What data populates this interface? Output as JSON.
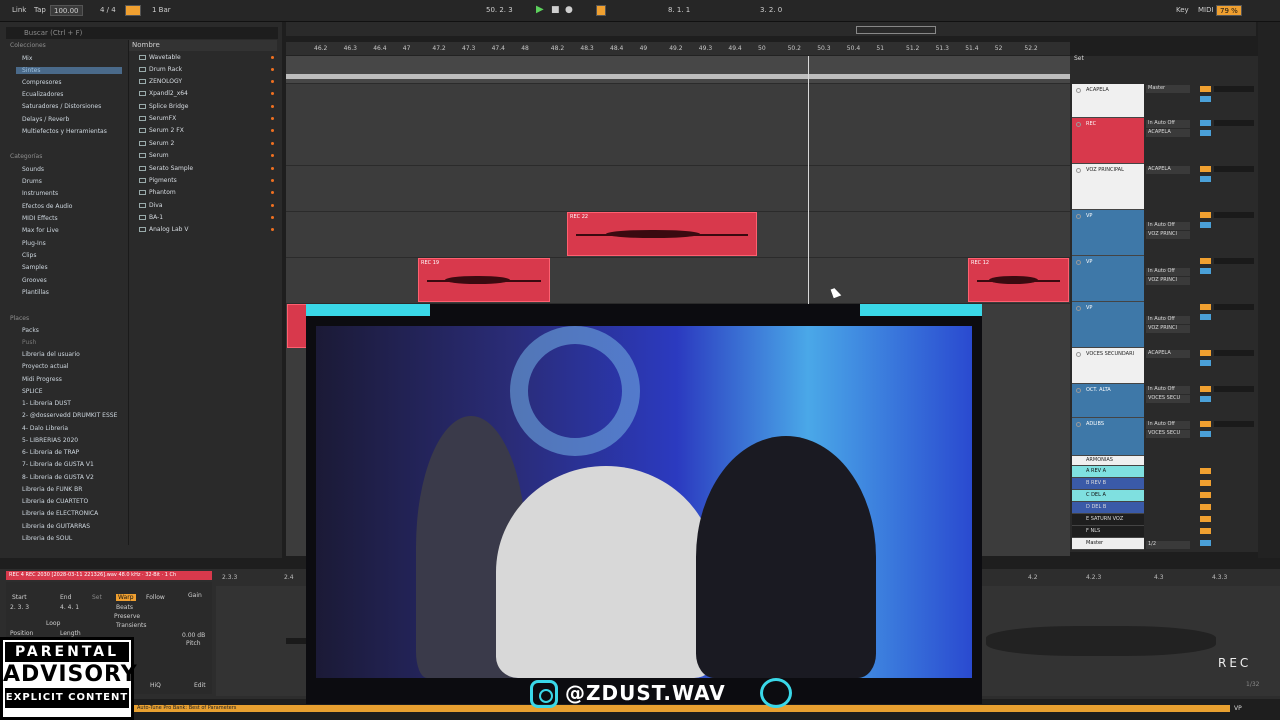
{
  "topbar": {
    "link": "Link",
    "tap": "Tap",
    "tempo": "100.00",
    "sig": "4 / 4",
    "metro": "1 Bar",
    "pos": "50. 2. 3",
    "loop_start": "8. 1. 1",
    "loop_len": "3. 2. 0",
    "key": "Key",
    "midi": "MIDI",
    "cpu": "79 %"
  },
  "browser": {
    "search_placeholder": "Buscar (Ctrl + F)",
    "collections_label": "Colecciones",
    "collections": [
      "Mix",
      "Sintes",
      "Compresores",
      "Ecualizadores",
      "Saturadores / Distorsiones",
      "Delays / Reverb",
      "Multiefectos y Herramientas"
    ],
    "categories_label": "Categorías",
    "categories": [
      "Sounds",
      "Drums",
      "Instruments",
      "Efectos de Audio",
      "MIDI Effects",
      "Max for Live",
      "Plug-Ins",
      "Clips",
      "Samples",
      "Grooves",
      "Plantillas"
    ],
    "places_label": "Places",
    "places": [
      "Packs",
      "Push",
      "Libreria del usuario",
      "Proyecto actual",
      "Midi Progress",
      "SPLICE",
      "1- Libreria DUST",
      "2- @dosservedd DRUMKIT ESSE",
      "4- Dalo Libreria",
      "5- LIBRERIAS 2020",
      "6- Libreria de TRAP",
      "7- Libreria de GUSTA V1",
      "8- Libreria de GUSTA V2",
      "Libreria de FUNK BR",
      "Libreria de CUARTETO",
      "Libreria de ELECTRONICA",
      "Libreria de GUITARRAS",
      "Libreria de SOUL"
    ],
    "name_header": "Nombre",
    "plugins": [
      "Wavetable",
      "Drum Rack",
      "ZENOLOGY",
      "Xpandl2_x64",
      "Splice Bridge",
      "SerumFX",
      "Serum 2 FX",
      "Serum 2",
      "Serum",
      "Serato Sample",
      "Pigments",
      "Phantom",
      "Diva",
      "BA-1",
      "Analog Lab V"
    ]
  },
  "ruler": [
    "46.2",
    "46.3",
    "46.4",
    "47",
    "47.2",
    "47.3",
    "47.4",
    "48",
    "48.2",
    "48.3",
    "48.4",
    "49",
    "49.2",
    "49.3",
    "49.4",
    "50",
    "50.2",
    "50.3",
    "50.4",
    "51",
    "51.2",
    "51.3",
    "51.4",
    "52",
    "52.2"
  ],
  "clips": {
    "c1": "REC 22",
    "c2": "REC 19",
    "c3": "REC 12"
  },
  "mixer": {
    "set_label": "Set",
    "tracks": [
      "ACAPELA",
      "REC",
      "VOZ PRINCIPAL",
      "VP",
      "VP",
      "VP",
      "VOCES SECUNDARI",
      "OCT. ALTA",
      "ADLIBS",
      "ARMONIAS",
      "A REV A",
      "B REV B",
      "C DEL A",
      "D DEL B",
      "E SATURN VOZ",
      "F NLS",
      "Master"
    ],
    "routing": {
      "master": "Master",
      "acapela": "ACAPELA",
      "in": "In",
      "auto": "Auto",
      "off": "Off",
      "vozp": "VOZ PRINCI",
      "voces": "VOCES SECU",
      "half": "1/2"
    }
  },
  "detail": {
    "clip_name": "REC 4  REC 2030 [2028-03-11 221326].wav",
    "clip_info": "48.0 kHz · 32-Bit · 1 Ch",
    "start": "Start",
    "end": "End",
    "set": "Set",
    "start_val": "2.  3.  3",
    "end_val": "4.  4.  1",
    "loop": "Loop",
    "position": "Position",
    "length": "Length",
    "warp": "Warp",
    "follow": "Follow",
    "beats": "Beats",
    "preserve": "Preserve",
    "transients": "Transients",
    "gain": "Gain",
    "gain_val": "0.00 dB",
    "pitch": "Pitch",
    "hiq": "HiQ",
    "edit": "Edit",
    "ruler": [
      "2.3.3",
      "2.4",
      "4.2",
      "4.2.3",
      "4.3",
      "4.3.3"
    ]
  },
  "status": {
    "text": "Auto-Tune Pro Bank: Best of Parameters",
    "vp": "VP"
  },
  "advisory": {
    "l1": "PARENTAL",
    "l2": "ADVISORY",
    "l3": "EXPLICIT CONTENT"
  },
  "overlay": {
    "handle": "@ZDUST.WAV",
    "rec": "REC",
    "counter": "1/32"
  }
}
